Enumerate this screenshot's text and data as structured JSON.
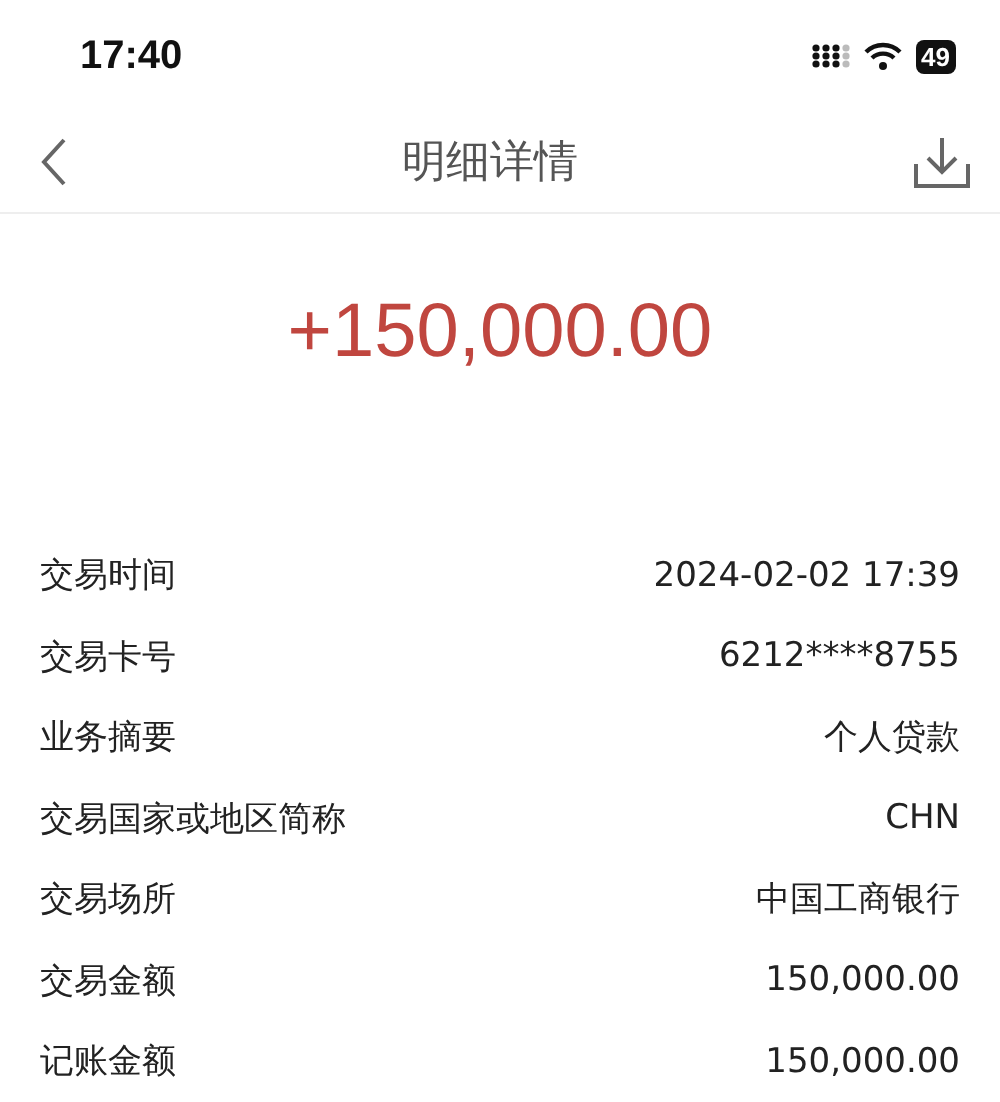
{
  "status_bar": {
    "time": "17:40",
    "battery": "49"
  },
  "nav": {
    "title": "明细详情"
  },
  "amount": "+150,000.00",
  "details": [
    {
      "label": "交易时间",
      "value": "2024-02-02 17:39"
    },
    {
      "label": "交易卡号",
      "value": "6212****8755"
    },
    {
      "label": "业务摘要",
      "value": "个人贷款"
    },
    {
      "label": "交易国家或地区简称",
      "value": "CHN"
    },
    {
      "label": "交易场所",
      "value": "中国工商银行"
    },
    {
      "label": "交易金额",
      "value": "150,000.00"
    },
    {
      "label": "记账金额",
      "value": "150,000.00"
    }
  ]
}
